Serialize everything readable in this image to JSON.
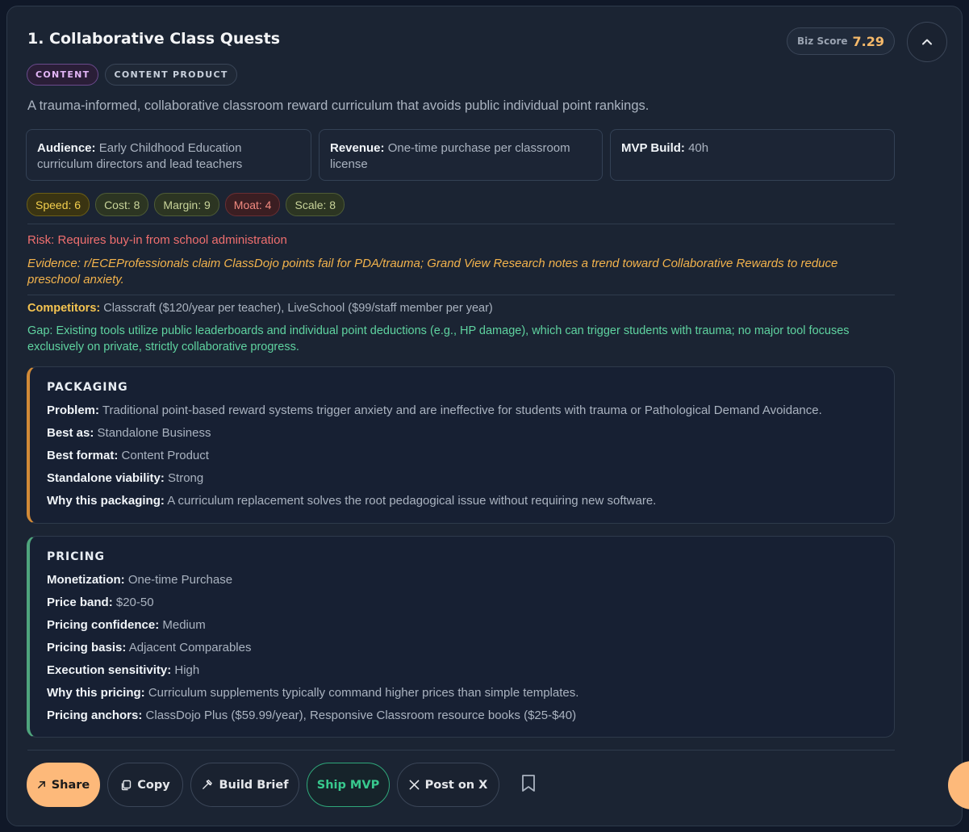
{
  "card": {
    "title": "1. Collaborative Class Quests",
    "biz_score_label": "Biz Score",
    "biz_score_value": "7.29",
    "tags": [
      "CONTENT",
      "CONTENT PRODUCT"
    ],
    "description": "A trauma-informed, collaborative classroom reward curriculum that avoids public individual point rankings."
  },
  "info": {
    "audience_label": "Audience:",
    "audience_value": "Early Childhood Education curriculum directors and lead teachers",
    "revenue_label": "Revenue:",
    "revenue_value": "One-time purchase per classroom license",
    "mvp_label": "MVP Build:",
    "mvp_value": "40h"
  },
  "metrics": {
    "speed": "Speed: 6",
    "cost": "Cost: 8",
    "margin": "Margin: 9",
    "moat": "Moat: 4",
    "scale": "Scale: 8"
  },
  "colors": {
    "accent_orange": "#fdb97a",
    "risk_red": "#f06f6f",
    "evidence_amber": "#f3b34c",
    "gap_green": "#5fd3a0",
    "packaging_bar": "#d28a37",
    "pricing_bar": "#4fa57d"
  },
  "risk": "Risk: Requires buy-in from school administration",
  "evidence": "Evidence: r/ECEProfessionals claim ClassDojo points fail for PDA/trauma; Grand View Research notes a trend toward Collaborative Rewards to reduce preschool anxiety.",
  "competitors": {
    "label": "Competitors:",
    "value": "Classcraft ($120/year per teacher), LiveSchool ($99/staff member per year)"
  },
  "gap": "Gap: Existing tools utilize public leaderboards and individual point deductions (e.g., HP damage), which can trigger students with trauma; no major tool focuses exclusively on private, strictly collaborative progress.",
  "packaging": {
    "heading": "PACKAGING",
    "rows": [
      {
        "label": "Problem:",
        "value": "Traditional point-based reward systems trigger anxiety and are ineffective for students with trauma or Pathological Demand Avoidance."
      },
      {
        "label": "Best as:",
        "value": "Standalone Business"
      },
      {
        "label": "Best format:",
        "value": "Content Product"
      },
      {
        "label": "Standalone viability:",
        "value": "Strong"
      },
      {
        "label": "Why this packaging:",
        "value": "A curriculum replacement solves the root pedagogical issue without requiring new software."
      }
    ]
  },
  "pricing": {
    "heading": "PRICING",
    "rows": [
      {
        "label": "Monetization:",
        "value": "One-time Purchase"
      },
      {
        "label": "Price band:",
        "value": "$20-50"
      },
      {
        "label": "Pricing confidence:",
        "value": "Medium"
      },
      {
        "label": "Pricing basis:",
        "value": "Adjacent Comparables"
      },
      {
        "label": "Execution sensitivity:",
        "value": "High"
      },
      {
        "label": "Why this pricing:",
        "value": "Curriculum supplements typically command higher prices than simple templates."
      },
      {
        "label": "Pricing anchors:",
        "value": "ClassDojo Plus ($59.99/year), Responsive Classroom resource books ($25-$40)"
      }
    ]
  },
  "actions": {
    "share": "Share",
    "copy": "Copy",
    "build_brief": "Build Brief",
    "ship_mvp": "Ship MVP",
    "post_on_x": "Post on X"
  },
  "icons": {
    "collapse": "chevron-up-icon",
    "share": "arrow-up-right-icon",
    "copy": "copy-icon",
    "build": "hammer-icon",
    "x": "x-logo-icon",
    "bookmark": "bookmark-icon"
  }
}
